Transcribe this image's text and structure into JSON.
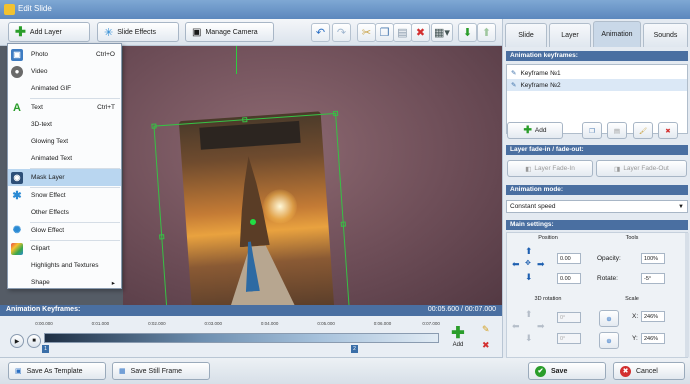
{
  "window": {
    "title": "Edit Slide"
  },
  "toolbar": {
    "add_layer": "Add Layer",
    "slide_effects": "Slide Effects",
    "manage_camera": "Manage Camera"
  },
  "menu": {
    "items": [
      {
        "label": "Photo",
        "shortcut": "Ctrl+O"
      },
      {
        "label": "Video",
        "shortcut": ""
      },
      {
        "label": "Animated GIF",
        "shortcut": ""
      },
      {
        "label": "Text",
        "shortcut": "Ctrl+T"
      },
      {
        "label": "3D-text",
        "shortcut": ""
      },
      {
        "label": "Glowing Text",
        "shortcut": ""
      },
      {
        "label": "Animated Text",
        "shortcut": ""
      },
      {
        "label": "Mask Layer",
        "shortcut": ""
      },
      {
        "label": "Snow Effect",
        "shortcut": ""
      },
      {
        "label": "Other Effects",
        "shortcut": ""
      },
      {
        "label": "Glow Effect",
        "shortcut": ""
      },
      {
        "label": "Clipart",
        "shortcut": ""
      },
      {
        "label": "Highlights and Textures",
        "shortcut": ""
      },
      {
        "label": "Shape",
        "shortcut": "▸"
      }
    ]
  },
  "keyframes_bar": {
    "title": "Animation Keyframes:",
    "time": "00:05.600 / 00:07.000"
  },
  "timeline": {
    "ticks": [
      "0:00.000",
      "0:01.000",
      "0:02.000",
      "0:03.000",
      "0:04.000",
      "0:05.000",
      "0:06.000",
      "0:07.000"
    ],
    "markers": [
      "1",
      "2"
    ],
    "add_label": "Add"
  },
  "bottom": {
    "save_template": "Save As Template",
    "save_still": "Save Still Frame",
    "save": "Save",
    "cancel": "Cancel"
  },
  "panel": {
    "tabs": [
      "Slide",
      "Layer",
      "Animation",
      "Sounds"
    ],
    "active_tab": "Animation",
    "anim_keyframes_hdr": "Animation keyframes:",
    "keyframes": [
      "Keyframe №1",
      "Keyframe №2"
    ],
    "add_label": "Add",
    "fade_hdr": "Layer fade-in / fade-out:",
    "fade_in": "Layer Fade-In",
    "fade_out": "Layer Fade-Out",
    "mode_hdr": "Animation mode:",
    "mode_value": "Constant speed",
    "main_hdr": "Main settings:",
    "position_hdr": "Position",
    "tools_hdr": "Tools",
    "pos_x": "0.00",
    "pos_y": "0.00",
    "opacity_label": "Opacity:",
    "opacity_value": "100%",
    "rotate_label": "Rotate:",
    "rotate_value": "-5°",
    "rotation3d_hdr": "3D rotation",
    "rot_a": "0°",
    "rot_b": "0°",
    "scale_hdr": "Scale",
    "scale_x_label": "X:",
    "scale_x_value": "246%",
    "scale_y_label": "Y:",
    "scale_y_value": "246%"
  },
  "colors": {
    "header_blue": "#4a6fa1",
    "selection_green": "#37c145",
    "menu_selected": "#b9d6f0"
  }
}
